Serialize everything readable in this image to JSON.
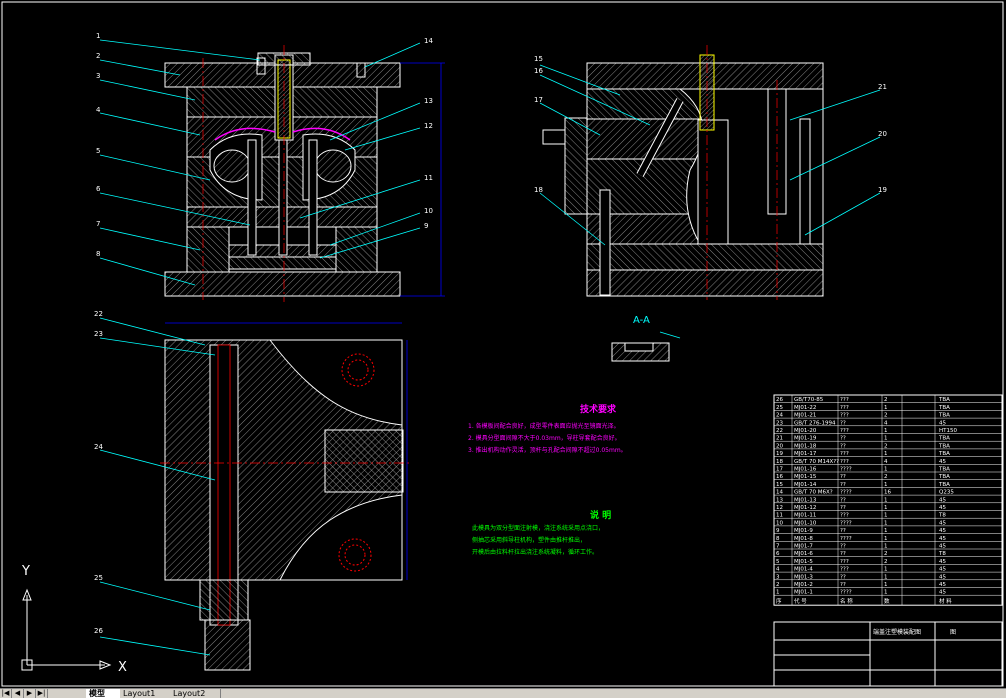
{
  "drawing": {
    "part_numbers": [
      "1",
      "2",
      "3",
      "4",
      "5",
      "6",
      "7",
      "8",
      "9",
      "10",
      "11",
      "12",
      "13",
      "14",
      "15",
      "16",
      "17",
      "18",
      "19",
      "20",
      "21",
      "22",
      "23",
      "24",
      "25",
      "26"
    ],
    "section_label": "A-A",
    "note1_title": "技术要求",
    "note1_lines": [
      "1. 各模板间配合良好，成型零件表面应抛光至镜面光泽。",
      "2. 模具分型面间隙不大于0.03mm，导柱导套配合良好。",
      "3. 推出机构动作灵活，顶杆与孔配合间隙不超过0.05mm。"
    ],
    "note2_title": "说 明",
    "note2_lines": [
      "此模具为双分型面注射模，浇注系统采用点浇口，",
      "侧抽芯采用斜导柱机构，塑件由推杆推出，",
      "开模后由拉料杆拉出浇注系统凝料，循环工作。"
    ],
    "ucs_x": "X",
    "ucs_y": "Y"
  },
  "bom": {
    "rows": [
      [
        "26",
        "GB/T70-85",
        "???",
        "2",
        "TBA"
      ],
      [
        "25",
        "MJ01-22",
        "???",
        "1",
        "TBA"
      ],
      [
        "24",
        "MJ01-21",
        "???",
        "2",
        "TBA"
      ],
      [
        "23",
        "GB/T 276-1994",
        "??",
        "4",
        "45"
      ],
      [
        "22",
        "MJ01-20",
        "???",
        "1",
        "HT150"
      ],
      [
        "21",
        "MJ01-19",
        "??",
        "1",
        "TBA"
      ],
      [
        "20",
        "MJ01-18",
        "??",
        "2",
        "TBA"
      ],
      [
        "19",
        "MJ01-17",
        "???",
        "1",
        "TBA"
      ],
      [
        "18",
        "GB/T 70 M14X??",
        "???",
        "4",
        "45"
      ],
      [
        "17",
        "MJ01-16",
        "????",
        "1",
        "TBA"
      ],
      [
        "16",
        "MJ01-15",
        "??",
        "2",
        "TBA"
      ],
      [
        "15",
        "MJ01-14",
        "??",
        "1",
        "TBA"
      ],
      [
        "14",
        "GB/T 70 M6X?",
        "????",
        "16",
        "Q235"
      ],
      [
        "13",
        "MJ01-13",
        "??",
        "1",
        "45"
      ],
      [
        "12",
        "MJ01-12",
        "??",
        "1",
        "45"
      ],
      [
        "11",
        "MJ01-11",
        "???",
        "1",
        "T8"
      ],
      [
        "10",
        "MJ01-10",
        "????",
        "1",
        "45"
      ],
      [
        "9",
        "MJ01-9",
        "??",
        "1",
        "45"
      ],
      [
        "8",
        "MJ01-8",
        "????",
        "1",
        "45"
      ],
      [
        "7",
        "MJ01-7",
        "??",
        "1",
        "45"
      ],
      [
        "6",
        "MJ01-6",
        "??",
        "2",
        "T8"
      ],
      [
        "5",
        "MJ01-5",
        "???",
        "2",
        "45"
      ],
      [
        "4",
        "MJ01-4",
        "???",
        "1",
        "45"
      ],
      [
        "3",
        "MJ01-3",
        "??",
        "1",
        "45"
      ],
      [
        "2",
        "MJ01-2",
        "??",
        "1",
        "45"
      ],
      [
        "1",
        "MJ01-1",
        "????",
        "1",
        "45"
      ]
    ],
    "header": [
      "序",
      "代 号",
      "名 称",
      "数",
      "材 料"
    ],
    "title_name": "端盖注塑模装配图",
    "title_company": "图"
  },
  "tabs": {
    "model": "模型",
    "layout1": "Layout1",
    "layout2": "Layout2"
  }
}
